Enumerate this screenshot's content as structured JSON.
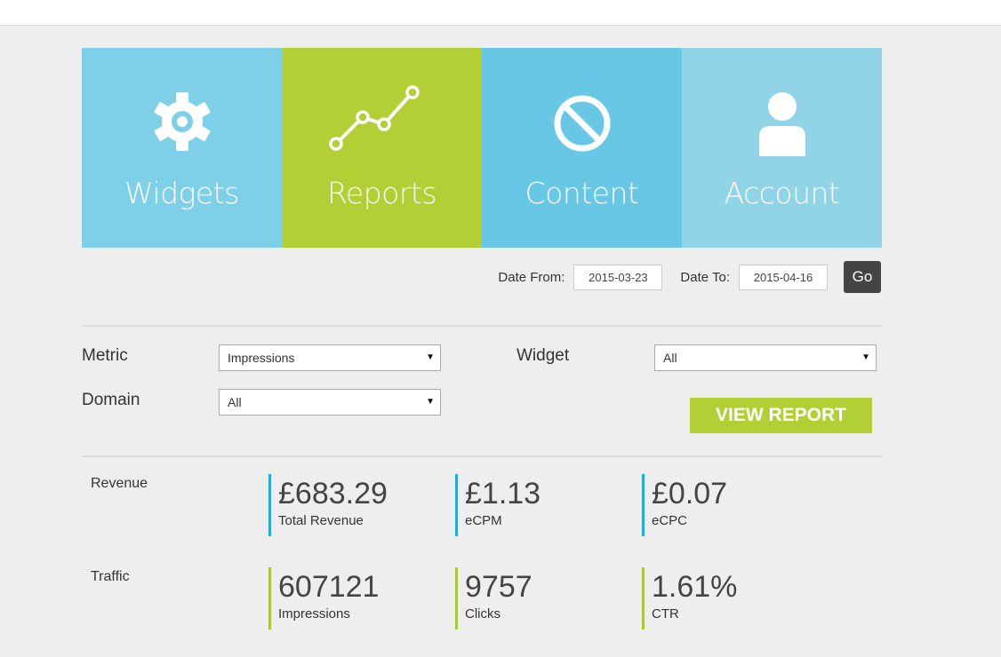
{
  "nav": {
    "tiles": [
      {
        "label": "Widgets",
        "icon": "gear-icon",
        "color": "#7dd0e8"
      },
      {
        "label": "Reports",
        "icon": "line-chart-icon",
        "color": "#b2cf35"
      },
      {
        "label": "Content",
        "icon": "no-entry-icon",
        "color": "#67c7e4"
      },
      {
        "label": "Account",
        "icon": "user-icon",
        "color": "#91d4e8"
      }
    ]
  },
  "dates": {
    "from_label": "Date From:",
    "from_value": "2015-03-23",
    "to_label": "Date To:",
    "to_value": "2015-04-16",
    "go_label": "Go"
  },
  "filters": {
    "metric_label": "Metric",
    "metric_value": "Impressions",
    "widget_label": "Widget",
    "widget_value": "All",
    "domain_label": "Domain",
    "domain_value": "All",
    "view_report_label": "VIEW REPORT"
  },
  "revenue": {
    "label": "Revenue",
    "stats": [
      {
        "value": "£683.29",
        "caption": "Total Revenue"
      },
      {
        "value": "£1.13",
        "caption": "eCPM"
      },
      {
        "value": "£0.07",
        "caption": "eCPC"
      }
    ]
  },
  "traffic": {
    "label": "Traffic",
    "stats": [
      {
        "value": "607121",
        "caption": "Impressions"
      },
      {
        "value": "9757",
        "caption": "Clicks"
      },
      {
        "value": "1.61%",
        "caption": "CTR"
      }
    ]
  },
  "colors": {
    "accent_green": "#b2cf35",
    "accent_blue": "#29a9d5",
    "go_button": "#444444"
  }
}
